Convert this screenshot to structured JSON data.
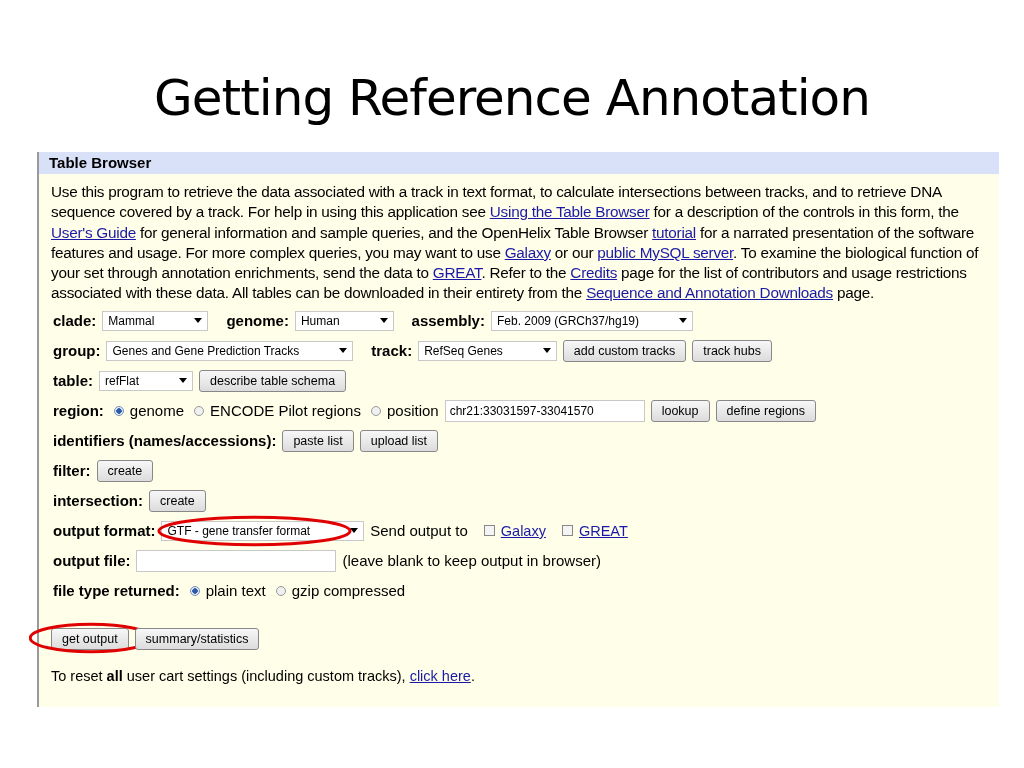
{
  "slide": {
    "title": "Getting Reference Annotation"
  },
  "browser": {
    "header": "Table Browser",
    "intro": [
      {
        "kind": "text",
        "text": "Use this program to retrieve the data associated with a track in text format, to calculate intersections between tracks, and to retrieve DNA sequence covered by a track. For help in using this application see "
      },
      {
        "kind": "link",
        "text": "Using the Table Browser"
      },
      {
        "kind": "text",
        "text": " for a description of the controls in this form, the "
      },
      {
        "kind": "link",
        "text": "User's Guide"
      },
      {
        "kind": "text",
        "text": " for general information and sample queries, and the OpenHelix Table Browser "
      },
      {
        "kind": "link",
        "text": "tutorial"
      },
      {
        "kind": "text",
        "text": " for a narrated presentation of the software features and usage. For more complex queries, you may want to use "
      },
      {
        "kind": "link",
        "text": "Galaxy"
      },
      {
        "kind": "text",
        "text": " or our "
      },
      {
        "kind": "link",
        "text": "public MySQL server"
      },
      {
        "kind": "text",
        "text": ". To examine the biological function of your set through annotation enrichments, send the data to "
      },
      {
        "kind": "link",
        "text": "GREAT"
      },
      {
        "kind": "text",
        "text": ". Refer to the "
      },
      {
        "kind": "link",
        "text": "Credits"
      },
      {
        "kind": "text",
        "text": " page for the list of contributors and usage restrictions associated with these data. All tables can be downloaded in their entirety from the "
      },
      {
        "kind": "link",
        "text": "Sequence and Annotation Downloads"
      },
      {
        "kind": "text",
        "text": " page."
      }
    ],
    "rows": [
      {
        "items": [
          {
            "kind": "label",
            "text": "clade:"
          },
          {
            "kind": "select",
            "value": "Mammal"
          },
          {
            "kind": "label",
            "text": "genome:"
          },
          {
            "kind": "select",
            "value": "Human"
          },
          {
            "kind": "label",
            "text": "assembly:"
          },
          {
            "kind": "select",
            "value": "Feb. 2009 (GRCh37/hg19)"
          }
        ]
      },
      {
        "items": [
          {
            "kind": "label",
            "text": "group:"
          },
          {
            "kind": "select",
            "value": "Genes and Gene Prediction Tracks"
          },
          {
            "kind": "label",
            "text": "track:"
          },
          {
            "kind": "select",
            "value": "RefSeq Genes"
          },
          {
            "kind": "button",
            "text": "add custom tracks"
          },
          {
            "kind": "button",
            "text": "track hubs"
          }
        ]
      },
      {
        "items": [
          {
            "kind": "label",
            "text": "table:"
          },
          {
            "kind": "select",
            "value": "refFlat"
          },
          {
            "kind": "button",
            "text": "describe table schema"
          }
        ]
      },
      {
        "items": [
          {
            "kind": "label",
            "text": "region:"
          },
          {
            "kind": "radio",
            "text": "genome",
            "selected": true
          },
          {
            "kind": "radio",
            "text": "ENCODE Pilot regions",
            "selected": false
          },
          {
            "kind": "radio",
            "text": "position",
            "selected": false
          },
          {
            "kind": "input",
            "value": "chr21:33031597-33041570"
          },
          {
            "kind": "button",
            "text": "lookup"
          },
          {
            "kind": "button",
            "text": "define regions"
          }
        ]
      },
      {
        "items": [
          {
            "kind": "label",
            "text": "identifiers (names/accessions):"
          },
          {
            "kind": "button",
            "text": "paste list"
          },
          {
            "kind": "button",
            "text": "upload list"
          }
        ]
      },
      {
        "items": [
          {
            "kind": "label",
            "text": "filter:"
          },
          {
            "kind": "button",
            "text": "create"
          }
        ]
      },
      {
        "items": [
          {
            "kind": "label",
            "text": "intersection:"
          },
          {
            "kind": "button",
            "text": "create"
          }
        ]
      },
      {
        "items": [
          {
            "kind": "label",
            "text": "output format:"
          },
          {
            "kind": "select",
            "value": "GTF - gene transfer format",
            "highlighted": true
          },
          {
            "kind": "text",
            "text": "Send output to"
          },
          {
            "kind": "checkbox",
            "text": "Galaxy",
            "checked": false
          },
          {
            "kind": "checkbox",
            "text": "GREAT",
            "checked": false
          }
        ]
      },
      {
        "items": [
          {
            "kind": "label",
            "text": "output file:"
          },
          {
            "kind": "input",
            "value": ""
          },
          {
            "kind": "text",
            "text": "(leave blank to keep output in browser)"
          }
        ]
      },
      {
        "items": [
          {
            "kind": "label",
            "text": "file type returned:"
          },
          {
            "kind": "radio",
            "text": "plain text",
            "selected": true
          },
          {
            "kind": "radio",
            "text": "gzip compressed",
            "selected": false
          }
        ]
      },
      {
        "kind": "spacer",
        "items": [
          {
            "kind": "button",
            "text": "get output",
            "highlighted": true
          },
          {
            "kind": "button",
            "text": "summary/statistics"
          }
        ]
      }
    ],
    "reset": [
      {
        "kind": "text",
        "text": "To reset **all** user cart settings (including custom tracks), "
      },
      {
        "kind": "link",
        "text": "click here"
      },
      {
        "kind": "text",
        "text": "."
      }
    ]
  }
}
